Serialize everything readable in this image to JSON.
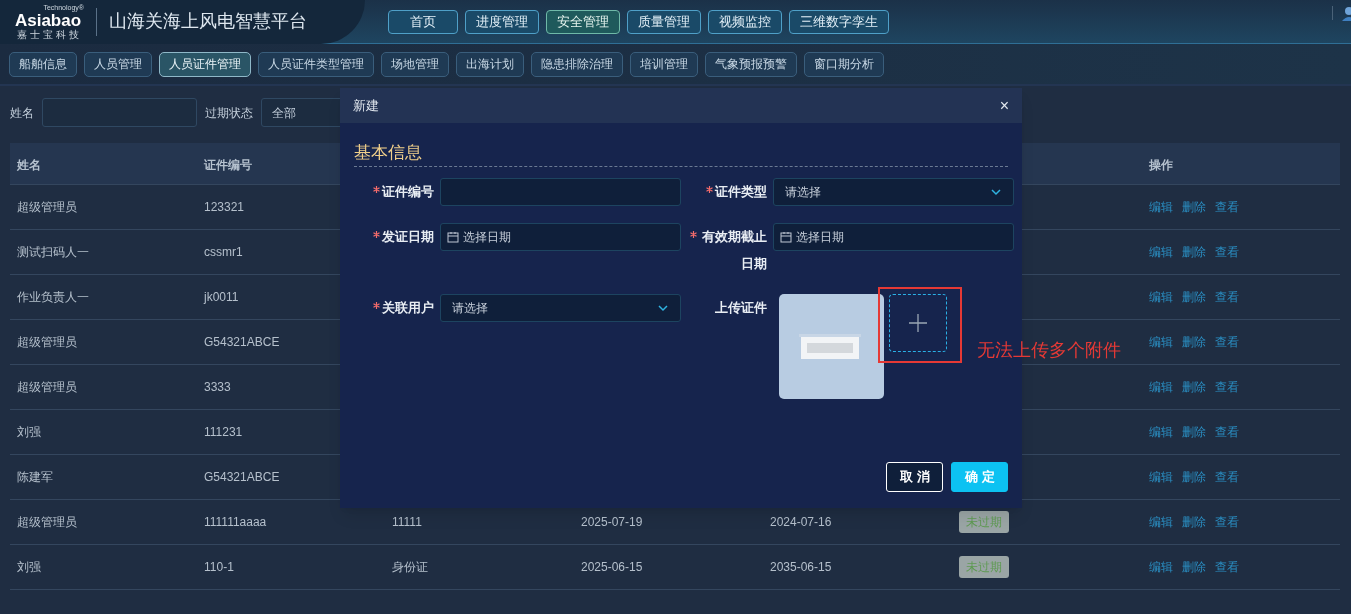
{
  "header": {
    "logo_sub": "Technology®",
    "logo_text": "Asiabao",
    "logo_cn": "嘉 士 宝 科 技",
    "title": "山海关海上风电智慧平台"
  },
  "nav": [
    {
      "label": "首页",
      "selected": false
    },
    {
      "label": "进度管理",
      "selected": false
    },
    {
      "label": "安全管理",
      "selected": true
    },
    {
      "label": "质量管理",
      "selected": false
    },
    {
      "label": "视频监控",
      "selected": false
    },
    {
      "label": "三维数字孪生",
      "selected": false
    }
  ],
  "subnav": [
    {
      "label": "船舶信息",
      "selected": false
    },
    {
      "label": "人员管理",
      "selected": false
    },
    {
      "label": "人员证件管理",
      "selected": true
    },
    {
      "label": "人员证件类型管理",
      "selected": false
    },
    {
      "label": "场地管理",
      "selected": false
    },
    {
      "label": "出海计划",
      "selected": false
    },
    {
      "label": "隐患排除治理",
      "selected": false
    },
    {
      "label": "培训管理",
      "selected": false
    },
    {
      "label": "气象预报预警",
      "selected": false
    },
    {
      "label": "窗口期分析",
      "selected": false
    }
  ],
  "filters": [
    {
      "kind": "text",
      "label": "姓名"
    },
    {
      "kind": "select",
      "label": "过期状态",
      "value": "全部"
    }
  ],
  "table": {
    "columns": {
      "name": "姓名",
      "cert_no": "证件编号",
      "actions": "操作"
    },
    "rows": [
      {
        "name": "超级管理员",
        "cert_no": "123321",
        "actions": [
          "编辑",
          "删除",
          "查看"
        ]
      },
      {
        "name": "测试扫码人一",
        "cert_no": "cssmr1",
        "actions": [
          "编辑",
          "删除",
          "查看"
        ]
      },
      {
        "name": "作业负责人一",
        "cert_no": "jk0011",
        "actions": [
          "编辑",
          "删除",
          "查看"
        ]
      },
      {
        "name": "超级管理员",
        "cert_no": "G54321ABCE",
        "actions": [
          "编辑",
          "删除",
          "查看"
        ]
      },
      {
        "name": "超级管理员",
        "cert_no": "3333",
        "actions": [
          "编辑",
          "删除",
          "查看"
        ]
      },
      {
        "name": "刘强",
        "cert_no": "111231",
        "actions": [
          "编辑",
          "删除",
          "查看"
        ]
      },
      {
        "name": "陈建军",
        "cert_no": "G54321ABCE",
        "actions": [
          "编辑",
          "删除",
          "查看"
        ]
      },
      {
        "name": "超级管理员",
        "cert_no": "111111aaaa",
        "column_3": "11111",
        "column_4": "2025-07-19",
        "column_5": "2024-07-16",
        "status": "未过期",
        "actions": [
          "编辑",
          "删除",
          "查看"
        ]
      },
      {
        "name": "刘强",
        "cert_no": "110-1",
        "column_3": "身份证",
        "column_4": "2025-06-15",
        "column_5": "2035-06-15",
        "status": "未过期",
        "actions": [
          "编辑",
          "删除",
          "查看"
        ]
      }
    ]
  },
  "dialog": {
    "title": "新建",
    "close": "×",
    "section": "基本信息",
    "fields": [
      {
        "kind": "text",
        "label": "证件编号",
        "required": true
      },
      {
        "kind": "select",
        "label": "证件类型",
        "required": true,
        "placeholder": "请选择"
      },
      {
        "kind": "date",
        "label": "发证日期",
        "required": true,
        "placeholder": "选择日期"
      },
      {
        "kind": "date",
        "label": "有效期截止日期",
        "required": true,
        "placeholder": "选择日期"
      },
      {
        "kind": "select",
        "label": "关联用户",
        "required": true,
        "placeholder": "请选择"
      },
      {
        "kind": "upload",
        "label": "上传证件",
        "required": false
      }
    ],
    "buttons": [
      {
        "kind": "cancel",
        "label": "取消"
      },
      {
        "kind": "ok",
        "label": "确定"
      }
    ]
  },
  "annotation": {
    "text": "无法上传多个附件"
  }
}
